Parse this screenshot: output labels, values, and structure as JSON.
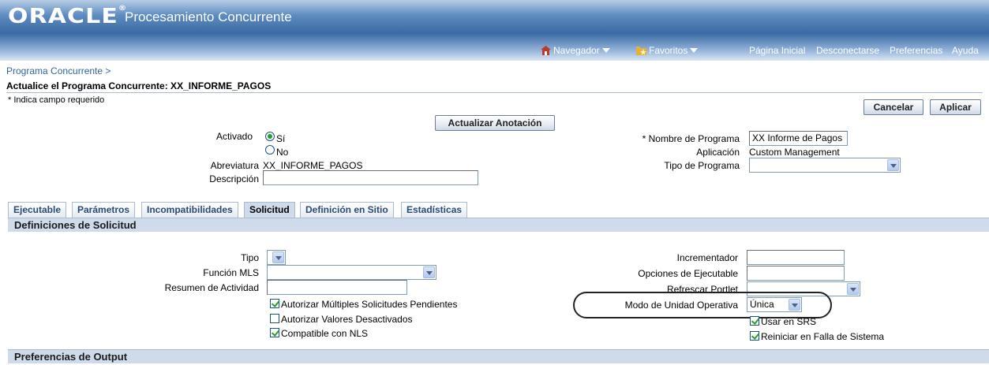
{
  "header": {
    "logo": "ORACLE",
    "title": "Procesamiento Concurrente",
    "nav_label": "Navegador",
    "fav_label": "Favoritos",
    "links": [
      "Página Inicial",
      "Desconectarse",
      "Preferencias",
      "Ayuda"
    ]
  },
  "breadcrumb": "Programa Concurrente  >",
  "page_title": "Actualice el Programa Concurrente: XX_INFORME_PAGOS",
  "required_note": "* Indica campo requerido",
  "buttons": {
    "cancel": "Cancelar",
    "apply": "Aplicar",
    "update_annotation": "Actualizar Anotación"
  },
  "form": {
    "activado_label": "Activado",
    "si_label": "Sí",
    "no_label": "No",
    "abreviatura_label": "Abreviatura",
    "abreviatura_value": "XX_INFORME_PAGOS",
    "descripcion_label": "Descripción",
    "descripcion_value": "",
    "nombre_label": "* Nombre de Programa",
    "nombre_value": "XX Informe de Pagos",
    "aplicacion_label": "Aplicación",
    "aplicacion_value": "Custom Management",
    "tipo_programa_label": "Tipo de Programa",
    "tipo_programa_value": ""
  },
  "tabs": [
    "Ejecutable",
    "Parámetros",
    "Incompatibilidades",
    "Solicitud",
    "Definición en Sitio",
    "Estadísticas"
  ],
  "selected_tab": "Solicitud",
  "section1": {
    "title": "Definiciones de Solicitud",
    "tipo_label": "Tipo",
    "funcion_label": "Función MLS",
    "resumen_label": "Resumen de Actividad",
    "chk_multiples": "Autorizar Múltiples Solicitudes Pendientes",
    "chk_desactivados": "Autorizar Valores Desactivados",
    "chk_nls": "Compatible con NLS",
    "incrementador_label": "Incrementador",
    "opciones_label": "Opciones de Ejecutable",
    "refrescar_label": "Refrescar Portlet",
    "modo_label": "Modo de Unidad Operativa",
    "modo_value": "Única",
    "chk_srs": "Usar en SRS",
    "chk_reiniciar": "Reiniciar en Falla de Sistema"
  },
  "section2": {
    "title": "Preferencias de Output"
  }
}
